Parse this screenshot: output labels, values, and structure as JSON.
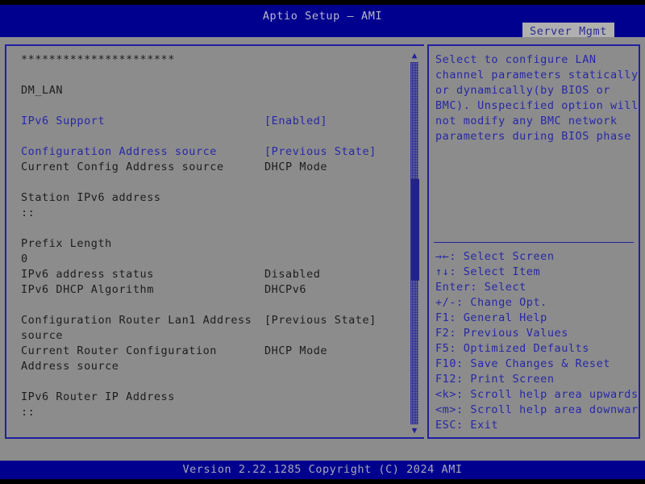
{
  "titlebar": {
    "title": "Aptio Setup – AMI",
    "tab_label": "Server Mgmt"
  },
  "main": {
    "header_asterisks": "**********************",
    "group_title": "DM_LAN",
    "rows": [
      {
        "label": "IPv6 Support",
        "value": "[Enabled]",
        "label_style": "blue",
        "value_style": "blue"
      },
      {
        "label": "",
        "value": "",
        "label_style": "spacer",
        "value_style": "spacer"
      },
      {
        "label": "Configuration Address source",
        "value": "[Previous State]",
        "label_style": "blue",
        "value_style": "blue"
      },
      {
        "label": "Current Config Address source",
        "value": "DHCP Mode",
        "label_style": "dark",
        "value_style": "dark"
      },
      {
        "label": "",
        "value": "",
        "label_style": "spacer",
        "value_style": "spacer"
      },
      {
        "label": "Station IPv6 address",
        "value": "",
        "label_style": "dark",
        "value_style": "dark"
      },
      {
        "label": "::",
        "value": "",
        "label_style": "dark",
        "value_style": "dark"
      },
      {
        "label": "",
        "value": "",
        "label_style": "spacer",
        "value_style": "spacer"
      },
      {
        "label": "Prefix Length",
        "value": "",
        "label_style": "dark",
        "value_style": "dark"
      },
      {
        "label": "0",
        "value": "",
        "label_style": "dark",
        "value_style": "dark"
      },
      {
        "label": "IPv6 address status",
        "value": "Disabled",
        "label_style": "dark",
        "value_style": "dark"
      },
      {
        "label": "IPv6 DHCP Algorithm",
        "value": "DHCPv6",
        "label_style": "dark",
        "value_style": "dark"
      },
      {
        "label": "",
        "value": "",
        "label_style": "spacer",
        "value_style": "spacer"
      },
      {
        "label": "Configuration Router Lan1 Address",
        "value": "[Previous State]",
        "label_style": "dark",
        "value_style": "dark"
      },
      {
        "label": "source",
        "value": "",
        "label_style": "dark",
        "value_style": "dark"
      },
      {
        "label": "Current Router Configuration",
        "value": "DHCP Mode",
        "label_style": "dark",
        "value_style": "dark"
      },
      {
        "label": "Address source",
        "value": "",
        "label_style": "dark",
        "value_style": "dark"
      },
      {
        "label": "",
        "value": "",
        "label_style": "spacer",
        "value_style": "spacer"
      },
      {
        "label": "IPv6 Router IP Address",
        "value": "",
        "label_style": "dark",
        "value_style": "dark"
      },
      {
        "label": "::",
        "value": "",
        "label_style": "dark",
        "value_style": "dark"
      }
    ],
    "scrollbar": {
      "up_arrow": "▲",
      "down_arrow": "▼"
    }
  },
  "help": {
    "description_lines": [
      "Select to configure LAN",
      "channel parameters statically",
      "or dynamically(by BIOS or",
      "BMC). Unspecified option will",
      "not modify any BMC network",
      "parameters during BIOS phase"
    ],
    "key_legend": [
      "→←: Select Screen",
      "↑↓: Select Item",
      "Enter: Select",
      "+/-: Change Opt.",
      "F1: General Help",
      "F2: Previous Values",
      "F5: Optimized Defaults",
      "F10: Save Changes & Reset",
      "F12: Print Screen",
      "<k>: Scroll help area upwards",
      "<m>: Scroll help area downwards",
      "ESC: Exit"
    ]
  },
  "footer": {
    "version_text": "Version 2.22.1285 Copyright (C) 2024 AMI"
  }
}
